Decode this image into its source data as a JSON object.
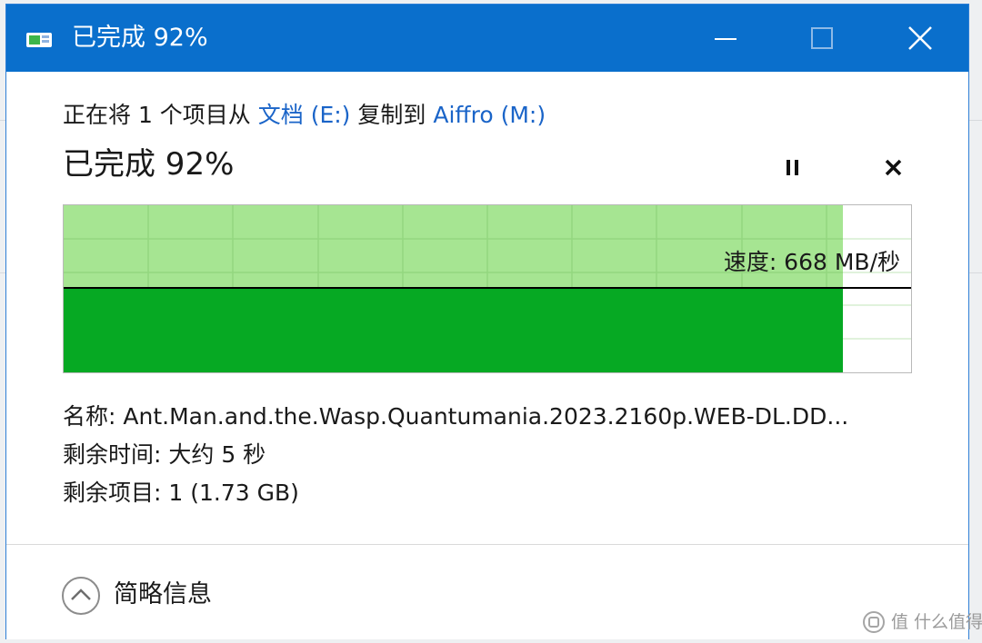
{
  "window": {
    "title": "已完成 92%",
    "controls": {
      "minimize_icon": "minimize-icon",
      "maximize_icon": "maximize-icon",
      "close_icon": "close-icon"
    }
  },
  "copy": {
    "prefix": "正在将 1 个项目从 ",
    "source": "文档 (E:)",
    "middle": " 复制到 ",
    "destination": "Aiffro (M:)",
    "status": "已完成 92%",
    "progress_fraction": 0.92,
    "pause_icon": "pause-icon",
    "cancel_icon": "cancel-icon"
  },
  "graph": {
    "speed_label": "速度: 668 MB/秒"
  },
  "details": {
    "name": "名称: Ant.Man.and.the.Wasp.Quantumania.2023.2160p.WEB-DL.DD...",
    "time_remaining": "剩余时间: 大约 5 秒",
    "items_remaining": "剩余项目: 1 (1.73 GB)"
  },
  "footer": {
    "toggle_label": "简略信息",
    "toggle_icon": "chevron-up-icon"
  },
  "watermark": {
    "text": "值 什么值得买"
  },
  "colors": {
    "titlebar": "#0a6fcc",
    "progress_light": "#a6e592",
    "progress_dark": "#06a923",
    "link": "#1a64c8"
  }
}
